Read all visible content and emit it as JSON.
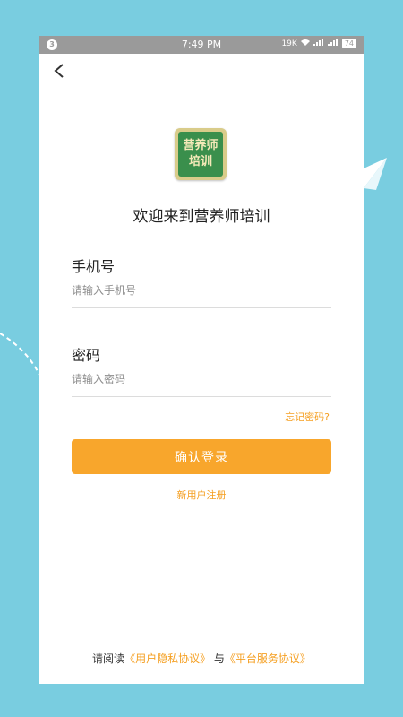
{
  "status_bar": {
    "notification_badge": "3",
    "time": "7:49 PM",
    "speed": "19K",
    "battery": "74"
  },
  "header": {
    "back_icon": "chevron-left-icon"
  },
  "logo": {
    "line1": "营养师",
    "line2": "培训"
  },
  "welcome": "欢迎来到营养师培训",
  "phone_field": {
    "label": "手机号",
    "placeholder": "请输入手机号",
    "value": ""
  },
  "password_field": {
    "label": "密码",
    "placeholder": "请输入密码",
    "value": ""
  },
  "forgot_password": "忘记密码?",
  "login_button": "确认登录",
  "register_link": "新用户注册",
  "agreement": {
    "prefix": "请阅读",
    "privacy": "《用户隐私协议》",
    "connector": "与",
    "service": "《平台服务协议》"
  },
  "colors": {
    "background": "#79cde0",
    "accent": "#f8a62c",
    "link": "#f5a023",
    "logo_green": "#3a8f4c"
  }
}
